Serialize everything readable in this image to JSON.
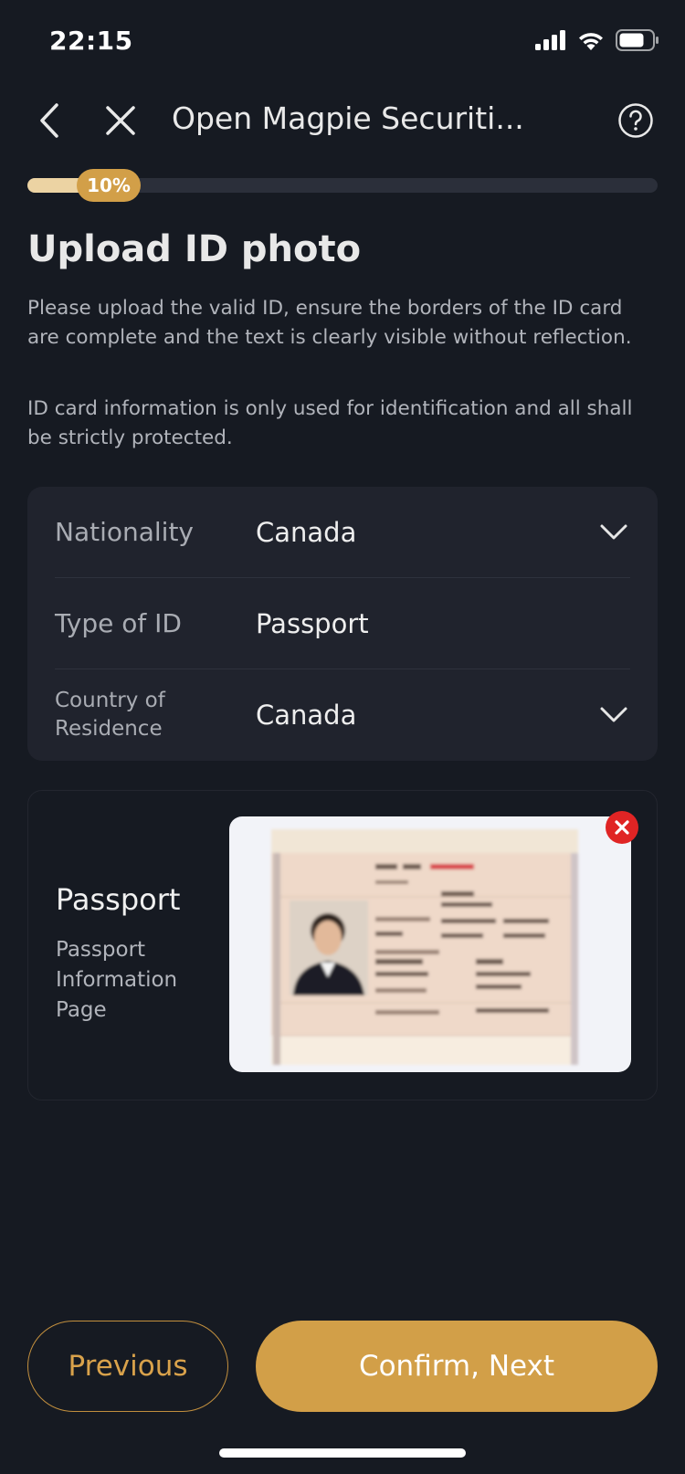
{
  "status_bar": {
    "time": "22:15",
    "icons": [
      "signal-icon",
      "wifi-icon",
      "battery-icon"
    ]
  },
  "nav": {
    "title": "Open Magpie Securiti...",
    "back_icon": "chevron-left-icon",
    "close_icon": "close-icon",
    "help_icon": "help-circle-icon"
  },
  "progress": {
    "label": "10%",
    "value": 0.1
  },
  "page": {
    "title": "Upload ID photo",
    "desc_1": "Please upload the valid ID, ensure the borders of the ID card are complete and the text is clearly visible without reflection.",
    "desc_2": "ID card information is only used for identification and all shall be strictly protected."
  },
  "form": {
    "nationality": {
      "label": "Nationality",
      "value": "Canada"
    },
    "id_type": {
      "label": "Type of ID",
      "value": "Passport"
    },
    "residence": {
      "label": "Country of Residence",
      "value": "Canada"
    }
  },
  "passport": {
    "title": "Passport",
    "subtitle": "Passport Information Page"
  },
  "buttons": {
    "previous": "Previous",
    "confirm": "Confirm, Next"
  },
  "colors": {
    "background": "#161a22",
    "card": "#20232d",
    "accent": "#d29f48",
    "progress_fill": "#ecd3a3",
    "remove": "#e02424"
  }
}
